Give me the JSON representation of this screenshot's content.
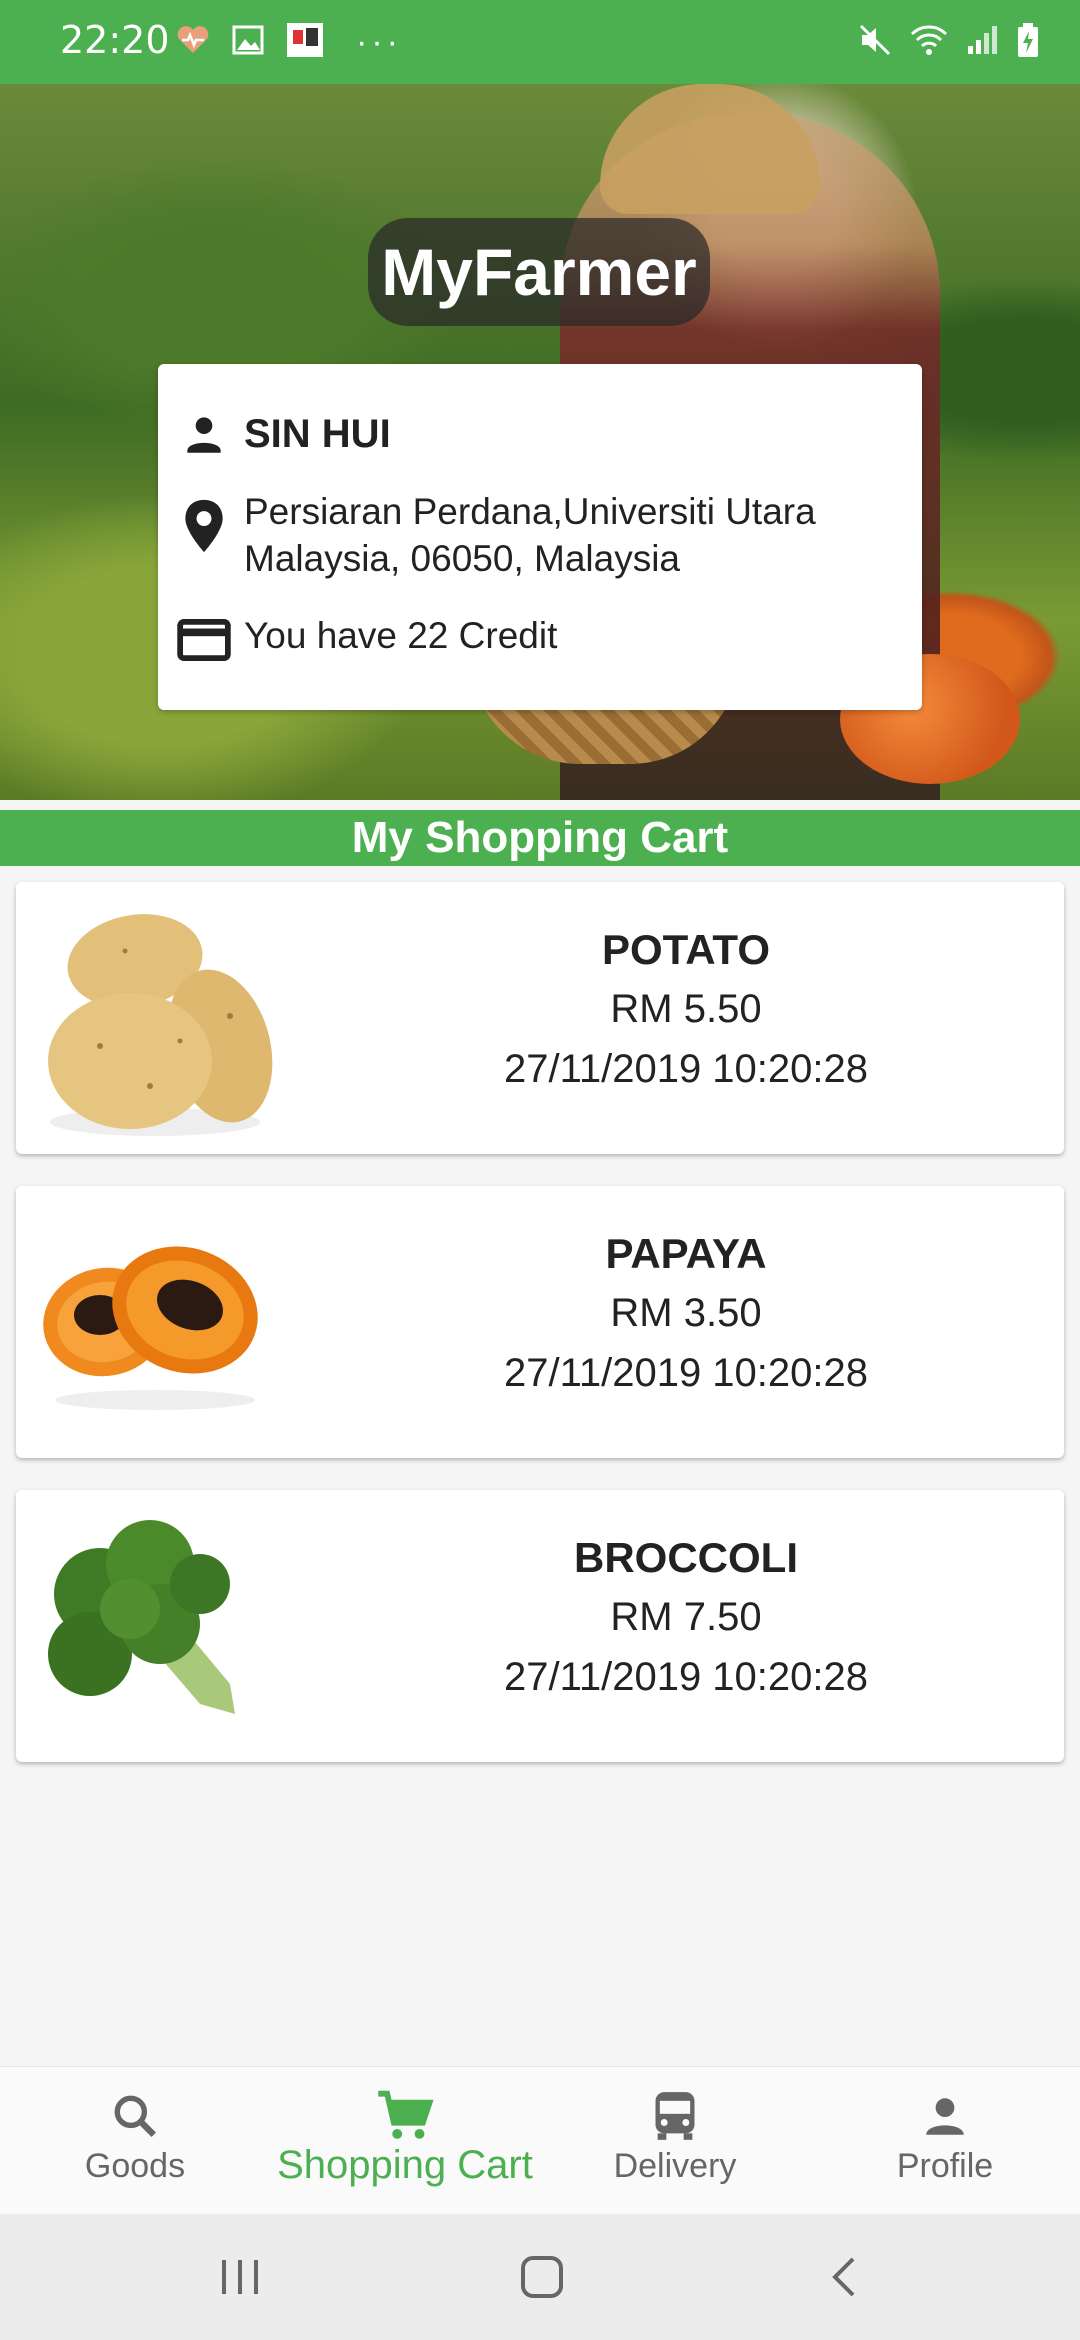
{
  "status_bar": {
    "time": "22:20",
    "icons": [
      "heart-rate-icon",
      "gallery-icon",
      "app-notification-icon",
      "more-dots-icon",
      "mute-icon",
      "wifi-icon",
      "signal-icon",
      "battery-charging-icon"
    ]
  },
  "header": {
    "app_title": "MyFarmer"
  },
  "profile": {
    "name": "SIN HUI",
    "address": "Persiaran Perdana,Universiti Utara Malaysia, 06050, Malaysia",
    "credit": "You have 22 Credit"
  },
  "cart": {
    "title": "My Shopping Cart",
    "items": [
      {
        "name": "POTATO",
        "price": "RM 5.50",
        "date": "27/11/2019 10:20:28",
        "image": "potato"
      },
      {
        "name": "PAPAYA",
        "price": "RM 3.50",
        "date": "27/11/2019 10:20:28",
        "image": "papaya"
      },
      {
        "name": "BROCCOLI",
        "price": "RM 7.50",
        "date": "27/11/2019 10:20:28",
        "image": "broccoli"
      }
    ]
  },
  "bottom_nav": {
    "items": [
      {
        "label": "Goods",
        "icon": "search-icon",
        "active": false
      },
      {
        "label": "Shopping Cart",
        "icon": "cart-icon",
        "active": true
      },
      {
        "label": "Delivery",
        "icon": "bus-icon",
        "active": false
      },
      {
        "label": "Profile",
        "icon": "person-icon",
        "active": false
      }
    ]
  },
  "colors": {
    "primary": "#4caf50",
    "text": "#222222",
    "inactive": "#666666"
  }
}
